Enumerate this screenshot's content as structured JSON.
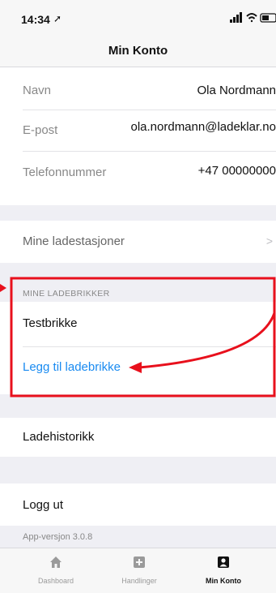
{
  "status": {
    "time": "14:34"
  },
  "nav": {
    "title": "Min Konto"
  },
  "profile": {
    "name_label": "Navn",
    "name_value": "Ola Nordmann",
    "email_label": "E-post",
    "email_value": "ola.nordmann@ladeklar.no",
    "phone_label": "Telefonnummer",
    "phone_value": "+47 00000000"
  },
  "stations": {
    "label": "Mine ladestasjoner"
  },
  "chips": {
    "header": "MINE LADEBRIKKER",
    "items": [
      "Testbrikke"
    ],
    "add_label": "Legg til ladebrikke"
  },
  "history": {
    "label": "Ladehistorikk"
  },
  "logout": {
    "label": "Logg ut"
  },
  "app_version": "App-versjon 3.0.8",
  "tabs": [
    {
      "label": "Dashboard",
      "icon": "home-icon",
      "active": false
    },
    {
      "label": "Handlinger",
      "icon": "plus-square-icon",
      "active": false
    },
    {
      "label": "Min Konto",
      "icon": "account-icon",
      "active": true
    }
  ],
  "colors": {
    "link": "#1a8bf1",
    "annotation": "#e8101c",
    "background": "#efeff4"
  }
}
